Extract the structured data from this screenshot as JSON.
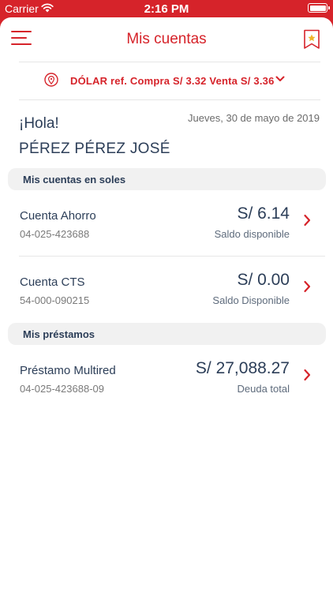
{
  "status_bar": {
    "carrier": "Carrier",
    "time": "2:16 PM"
  },
  "header": {
    "title": "Mis cuentas"
  },
  "exchange": {
    "text": "DÓLAR ref. Compra S/ 3.32 Venta S/ 3.36"
  },
  "greeting": {
    "hello": "¡Hola!",
    "date": "Jueves, 30 de mayo de 2019",
    "user_name": "PÉREZ PÉREZ JOSÉ"
  },
  "sections": {
    "soles_title": "Mis cuentas en soles",
    "loans_title": "Mis préstamos"
  },
  "accounts": [
    {
      "name": "Cuenta Ahorro",
      "number": "04-025-423688",
      "amount": "S/ 6.14",
      "sub": "Saldo disponible"
    },
    {
      "name": "Cuenta CTS",
      "number": "54-000-090215",
      "amount": "S/ 0.00",
      "sub": "Saldo Disponible"
    }
  ],
  "loans": [
    {
      "name": "Préstamo Multired",
      "number": "04-025-423688-09",
      "amount": "S/ 27,088.27",
      "sub": "Deuda total"
    }
  ],
  "colors": {
    "brand_red": "#d6232a",
    "text_navy": "#2c3e58",
    "section_bg": "#f1f1f1"
  },
  "icons": {
    "menu": "hamburger-icon",
    "bookmark": "bookmark-star-icon",
    "location": "location-pin-icon",
    "expand": "chevron-down-icon",
    "row": "chevron-right-icon"
  }
}
